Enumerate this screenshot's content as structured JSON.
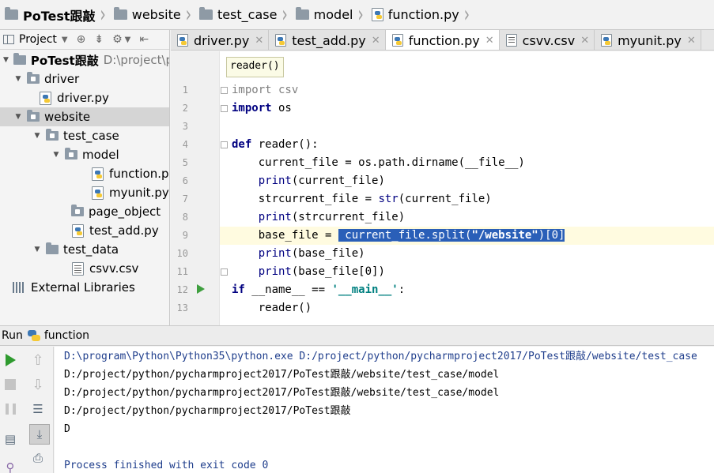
{
  "breadcrumb": [
    "PoTest跟敲",
    "website",
    "test_case",
    "model",
    "function.py"
  ],
  "project_panel": {
    "toolbar_label": "Project",
    "tree": [
      {
        "label": "PoTest跟敲",
        "path": "D:\\project\\p",
        "type": "root"
      },
      {
        "label": "driver",
        "type": "folder"
      },
      {
        "label": "driver.py",
        "type": "py"
      },
      {
        "label": "website",
        "type": "folder"
      },
      {
        "label": "test_case",
        "type": "folder"
      },
      {
        "label": "model",
        "type": "folder"
      },
      {
        "label": "function.py",
        "type": "py"
      },
      {
        "label": "myunit.py",
        "type": "py"
      },
      {
        "label": "page_object",
        "type": "folder"
      },
      {
        "label": "test_add.py",
        "type": "py"
      },
      {
        "label": "test_data",
        "type": "folder"
      },
      {
        "label": "csvv.csv",
        "type": "csv"
      },
      {
        "label": "External Libraries",
        "type": "lib"
      }
    ]
  },
  "editor": {
    "tabs": [
      {
        "label": "driver.py",
        "type": "py",
        "active": false
      },
      {
        "label": "test_add.py",
        "type": "py",
        "active": false
      },
      {
        "label": "function.py",
        "type": "py",
        "active": true
      },
      {
        "label": "csvv.csv",
        "type": "csv",
        "active": false
      },
      {
        "label": "myunit.py",
        "type": "py",
        "active": false
      }
    ],
    "hint": "reader()",
    "line_numbers": [
      "1",
      "2",
      "3",
      "4",
      "5",
      "6",
      "7",
      "8",
      "9",
      "10",
      "11",
      "12",
      "13"
    ],
    "code": {
      "l1_kw": "import",
      "l1_mod": " csv",
      "l2_kw": "import",
      "l2_mod": " os",
      "l4_kw": "def",
      "l4_rest": " reader():",
      "l5": "    current_file = os.path.dirname(__file__)",
      "l6_fn": "print",
      "l6_rest": "(current_file)",
      "l7_a": "    strcurrent_file = ",
      "l7_fn": "str",
      "l7_b": "(current_file)",
      "l8_fn": "print",
      "l8_rest": "(strcurrent_file)",
      "l9_a": "    base_file = ",
      "l9_sel_a": " current_file.split(",
      "l9_str": "\"/website\"",
      "l9_sel_b": ")[0]",
      "l10_fn": "print",
      "l10_rest": "(base_file)",
      "l11_fn": "print",
      "l11_rest": "(base_file[0])",
      "l12_kw": "if",
      "l12_a": " __name__ == ",
      "l12_str": "'__main__'",
      "l12_b": ":",
      "l13": "    reader()"
    }
  },
  "run_panel": {
    "title": "Run",
    "config": "function",
    "output": [
      "D:\\program\\Python\\Python35\\python.exe D:/project/python/pycharmproject2017/PoTest跟敲/website/test_case",
      "D:/project/python/pycharmproject2017/PoTest跟敲/website/test_case/model",
      "D:/project/python/pycharmproject2017/PoTest跟敲/website/test_case/model",
      "D:/project/python/pycharmproject2017/PoTest跟敲",
      "D",
      "",
      "Process finished with exit code 0"
    ]
  },
  "colors": {
    "keyword": "#000080",
    "string": "#008080",
    "selection": "#2a5fb8",
    "run_green": "#2f9b2f"
  }
}
